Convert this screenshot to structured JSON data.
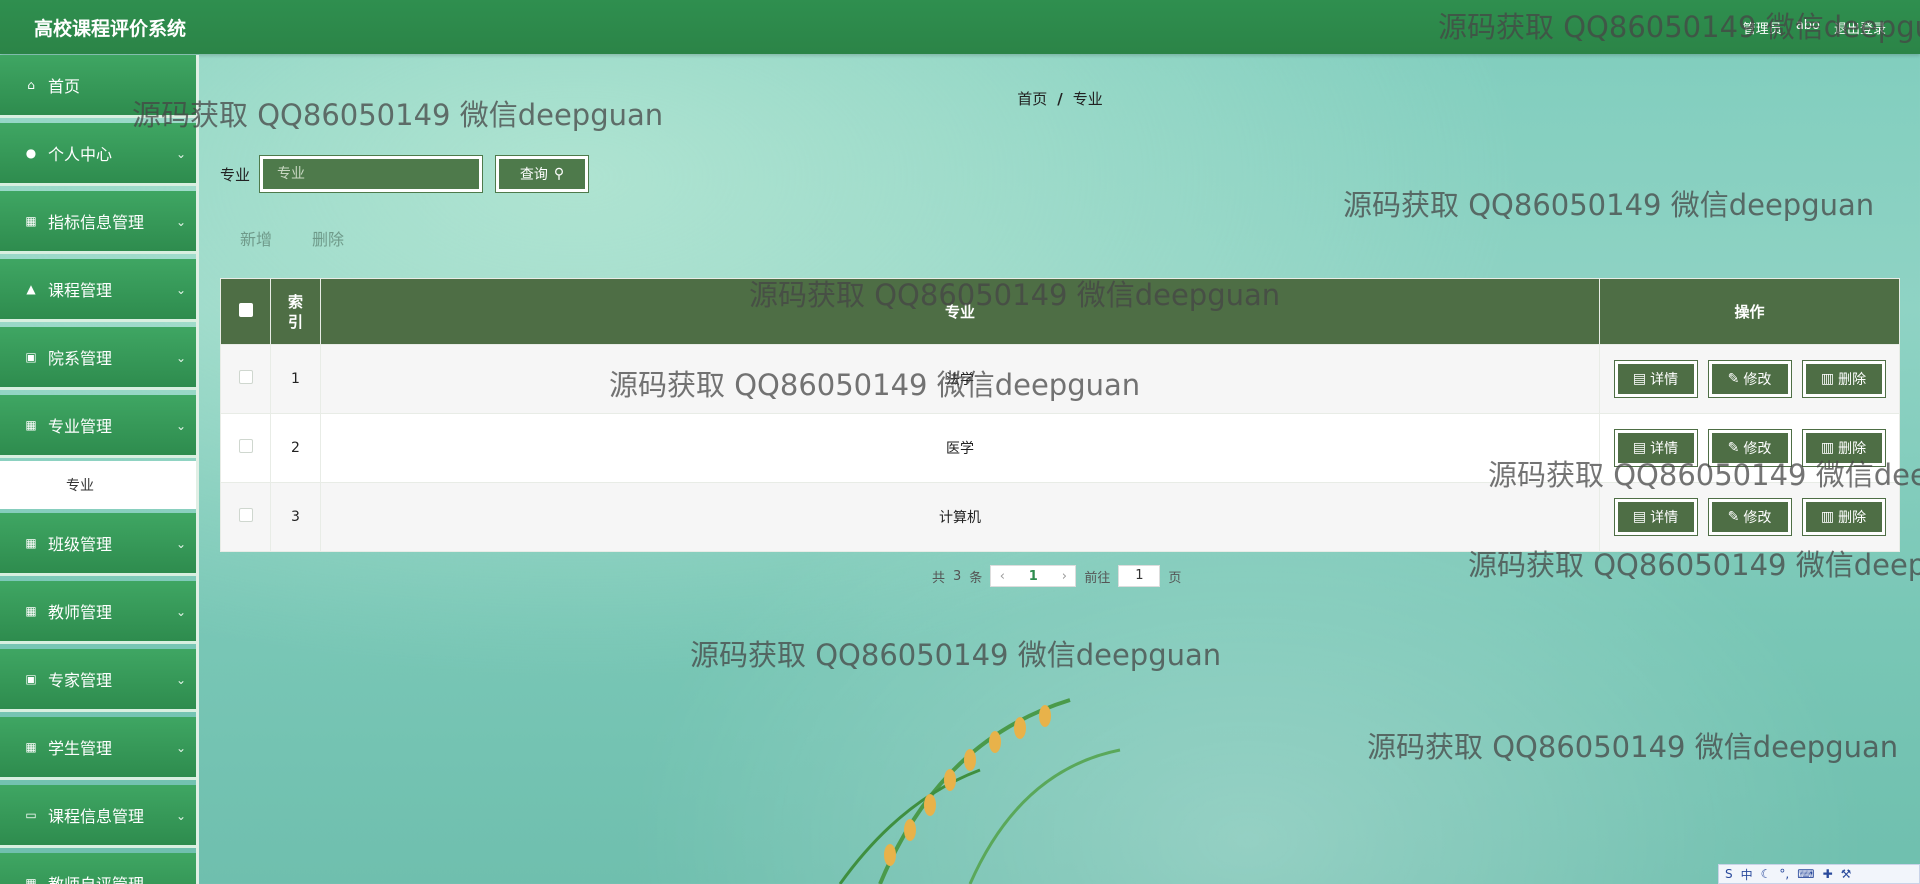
{
  "app": {
    "title": "高校课程评价系统",
    "header_right": [
      "管理员",
      "abo",
      "退出登录"
    ]
  },
  "sidebar": {
    "items": [
      {
        "label": "首页",
        "icon": "home-icon",
        "has_chevron": false
      },
      {
        "label": "个人中心",
        "icon": "user-icon",
        "has_chevron": true
      },
      {
        "label": "指标信息管理",
        "icon": "grid-icon",
        "has_chevron": true
      },
      {
        "label": "课程管理",
        "icon": "thumb-icon",
        "has_chevron": true
      },
      {
        "label": "院系管理",
        "icon": "clipboard-icon",
        "has_chevron": true
      },
      {
        "label": "专业管理",
        "icon": "grid-icon",
        "has_chevron": true
      },
      {
        "label": "班级管理",
        "icon": "grid-icon",
        "has_chevron": true
      },
      {
        "label": "教师管理",
        "icon": "grid-icon",
        "has_chevron": true
      },
      {
        "label": "专家管理",
        "icon": "clipboard-icon",
        "has_chevron": true
      },
      {
        "label": "学生管理",
        "icon": "grid-icon",
        "has_chevron": true
      },
      {
        "label": "课程信息管理",
        "icon": "monitor-icon",
        "has_chevron": true
      },
      {
        "label": "教师自评管理",
        "icon": "grid-icon",
        "has_chevron": true
      }
    ],
    "active_sub": "专业"
  },
  "breadcrumb": {
    "home": "首页",
    "sep": "/",
    "current": "专业"
  },
  "search": {
    "label": "专业",
    "placeholder": "专业",
    "button": "查询"
  },
  "actions": {
    "add": "新增",
    "delete": "删除"
  },
  "table": {
    "headers": {
      "index": "索引",
      "major": "专业",
      "ops": "操作"
    },
    "rows": [
      {
        "index": "1",
        "major": "法学"
      },
      {
        "index": "2",
        "major": "医学"
      },
      {
        "index": "3",
        "major": "计算机"
      }
    ],
    "op_labels": {
      "detail": "详情",
      "edit": "修改",
      "remove": "删除"
    }
  },
  "pager": {
    "total_prefix": "共",
    "total": "3",
    "total_suffix": "条",
    "current": "1",
    "goto_prefix": "前往",
    "goto_value": "1",
    "goto_suffix": "页"
  },
  "watermark": "源码获取 QQ86050149 微信deepguan",
  "colors": {
    "header": "#2f8f4f",
    "table_header": "#4e6e45",
    "button": "#4e7a4b"
  }
}
